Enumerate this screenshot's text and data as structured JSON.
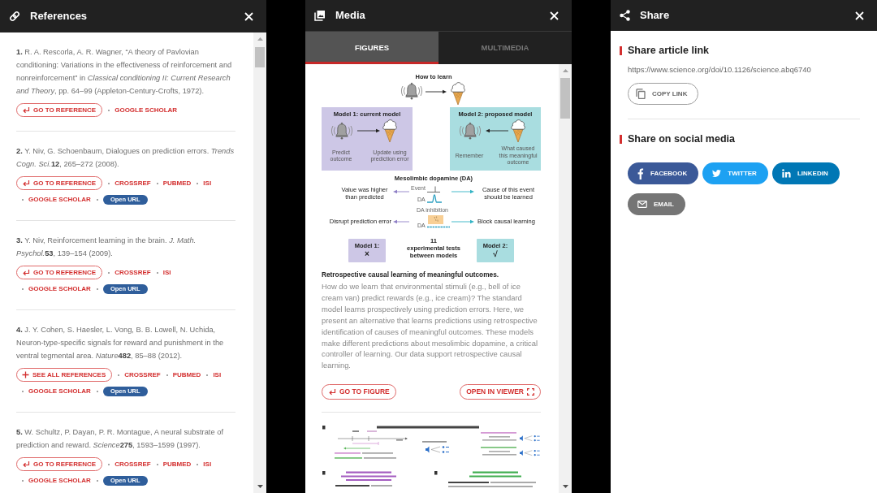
{
  "references_panel": {
    "title": "References",
    "references": [
      {
        "number": "1.",
        "citation": "R. A. Rescorla, A. R. Wagner, “A theory of Pavlovian conditioning: Variations in the effectiveness of reinforcement and nonreinforcement” in *Classical conditioning II: Current Research and Theory*, pp. 64–99 (Appleton-Century-Crofts, 1972).",
        "links": [
          {
            "kind": "go",
            "label": "GO TO REFERENCE"
          },
          {
            "kind": "link",
            "label": "GOOGLE SCHOLAR"
          }
        ]
      },
      {
        "number": "2.",
        "citation": "Y. Niv, G. Schoenbaum, Dialogues on prediction errors. *Trends Cogn. Sci.*",
        "volume": "12",
        "pages": ", 265–272 (2008).",
        "links": [
          {
            "kind": "go",
            "label": "GO TO REFERENCE"
          },
          {
            "kind": "link",
            "label": "CROSSREF"
          },
          {
            "kind": "link",
            "label": "PUBMED"
          },
          {
            "kind": "link",
            "label": "ISI"
          },
          {
            "kind": "link",
            "label": "GOOGLE SCHOLAR"
          },
          {
            "kind": "badge",
            "label": "Open URL"
          }
        ]
      },
      {
        "number": "3.",
        "citation": "Y. Niv, Reinforcement learning in the brain. *J. Math. Psychol.*",
        "volume": "53",
        "pages": ", 139–154 (2009).",
        "links": [
          {
            "kind": "go",
            "label": "GO TO REFERENCE"
          },
          {
            "kind": "link",
            "label": "CROSSREF"
          },
          {
            "kind": "link",
            "label": "ISI"
          },
          {
            "kind": "link",
            "label": "GOOGLE SCHOLAR"
          },
          {
            "kind": "badge",
            "label": "Open URL"
          }
        ]
      },
      {
        "number": "4.",
        "citation": "J. Y. Cohen, S. Haesler, L. Vong, B. B. Lowell, N. Uchida, Neuron-type-specific signals for reward and punishment in the ventral tegmental area. *Nature*",
        "volume": "482",
        "pages": ", 85–88 (2012).",
        "links": [
          {
            "kind": "expand",
            "label": "SEE ALL REFERENCES"
          },
          {
            "kind": "link",
            "label": "CROSSREF"
          },
          {
            "kind": "link",
            "label": "PUBMED"
          },
          {
            "kind": "link",
            "label": "ISI"
          },
          {
            "kind": "link",
            "label": "GOOGLE SCHOLAR"
          },
          {
            "kind": "badge",
            "label": "Open URL"
          }
        ]
      },
      {
        "number": "5.",
        "citation": "W. Schultz, P. Dayan, P. R. Montague, A neural substrate of prediction and reward. *Science*",
        "volume": "275",
        "pages": ", 1593–1599 (1997).",
        "links": [
          {
            "kind": "go",
            "label": "GO TO REFERENCE"
          },
          {
            "kind": "link",
            "label": "CROSSREF"
          },
          {
            "kind": "link",
            "label": "PUBMED"
          },
          {
            "kind": "link",
            "label": "ISI"
          },
          {
            "kind": "link",
            "label": "GOOGLE SCHOLAR"
          },
          {
            "kind": "badge",
            "label": "Open URL"
          }
        ]
      }
    ]
  },
  "media_panel": {
    "title": "Media",
    "tabs": [
      {
        "label": "FIGURES",
        "selected": true
      },
      {
        "label": "MULTIMEDIA",
        "selected": false
      }
    ],
    "figure": {
      "heading": "How to learn",
      "models": [
        {
          "title": "Model 1: current model",
          "color": "#cdc7e6",
          "reversed": false,
          "cue_label": "Predict outcome",
          "outcome_label": "Update using prediction error",
          "verdict": "Model 1:",
          "verdict_mark": "×"
        },
        {
          "title": "Model 2: proposed model",
          "color": "#a9dde0",
          "reversed": true,
          "cue_label": "Remember",
          "outcome_label": "What caused this meaningful outcome",
          "verdict": "Model 2:",
          "verdict_mark": "√"
        }
      ],
      "dopamine": {
        "heading": "Mesolimbic dopamine (DA)",
        "rows": [
          {
            "kind": "burst",
            "effect_model_1": "Value was higher than predicted",
            "event_label": "Event",
            "trace_label": "DA",
            "effect_model_2": "Cause of this event should be learned"
          },
          {
            "kind": "inhibition",
            "effect_model_1": "Disrupt prediction error",
            "event_label": "DA inhibition",
            "trace_label": "DA",
            "effect_model_2": "Block causal learning"
          }
        ]
      },
      "tests": {
        "count": "11",
        "label": "experimental tests between models"
      }
    },
    "caption_title": "Retrospective causal learning of meaningful outcomes.",
    "caption": "How do we learn that environmental stimuli (e.g., bell of ice cream van) predict rewards (e.g., ice cream)? The standard model learns prospectively using prediction errors. Here, we present an alternative that learns predictions using retrospective identification of causes of meaningful outcomes. These models make different predictions about mesolimbic dopamine, a critical controller of learning. Our data support retrospective causal learning.",
    "actions": [
      {
        "kind": "go",
        "label": "GO TO FIGURE"
      },
      {
        "kind": "viewer",
        "label": "OPEN IN VIEWER"
      }
    ]
  },
  "share_panel": {
    "title": "Share",
    "link_section": {
      "heading": "Share article link",
      "url": "https://www.science.org/doi/10.1126/science.abq6740",
      "copy_label": "COPY LINK"
    },
    "social_section": {
      "heading": "Share on social media",
      "buttons": [
        {
          "kind": "facebook",
          "label": "FACEBOOK",
          "color": "#3b5998"
        },
        {
          "kind": "twitter",
          "label": "TWITTER",
          "color": "#1da1f2"
        },
        {
          "kind": "linkedin",
          "label": "LINKEDIN",
          "color": "#0077b5"
        },
        {
          "kind": "email",
          "label": "EMAIL",
          "color": "#757575"
        }
      ]
    }
  }
}
